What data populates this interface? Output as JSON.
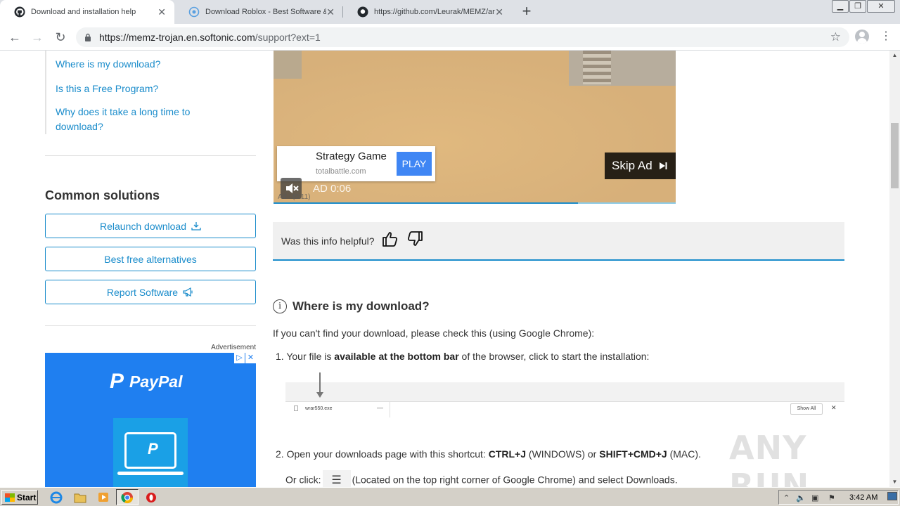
{
  "browser": {
    "tabs": [
      {
        "title": "Download and installation help",
        "active": true,
        "favicon": "github-icon"
      },
      {
        "title": "Download Roblox - Best Software &",
        "active": false,
        "favicon": "softonic-icon"
      },
      {
        "title": "https://github.com/Leurak/MEMZ/ar",
        "active": false,
        "favicon": "github-icon"
      }
    ],
    "url_host": "https://memz-trojan.en.softonic.com",
    "url_path": "/support?ext=1"
  },
  "sidebar": {
    "faq_links": [
      "Where is my download?",
      "Is this a Free Program?",
      "Why does it take a long time to download?"
    ],
    "common_title": "Common solutions",
    "buttons": [
      "Relaunch download",
      "Best free alternatives",
      "Report Software"
    ],
    "ad_label": "Advertisement",
    "ad_brand": "PayPal"
  },
  "video_ad": {
    "promo_title": "Strategy Game",
    "promo_domain": "totalbattle.com",
    "play_label": "PLAY",
    "skip_label": "Skip Ad",
    "timer": "AD  0:06",
    "small": "Ad · (0:11)",
    "progress": 0.757
  },
  "feedback": {
    "question": "Was this info helpful?"
  },
  "article": {
    "heading": "Where is my download?",
    "intro": "If you can't find your download, please check this (using Google Chrome):",
    "step1_pre": "1. Your file is ",
    "step1_bold": "available at the bottom bar",
    "step1_post": " of the browser, click to start the installation:",
    "dl_filename": "wrar550.exe",
    "dl_showall": "Show All",
    "step2_pre": "2. Open your downloads page with this shortcut: ",
    "step2_k1": "CTRL+J",
    "step2_mid": " (WINDOWS) or ",
    "step2_k2": "SHIFT+CMD+J",
    "step2_post": " (MAC).",
    "step3_pre": "Or click:",
    "step3_post": "(Located on the top right corner of Google Chrome) and select Downloads."
  },
  "watermark": "ANY RUN",
  "taskbar": {
    "start": "Start",
    "clock": "3:42 AM"
  },
  "colors": {
    "link": "#1a8ccb",
    "paypal_bg": "#1f7ff0",
    "play_btn": "#3f86f4"
  }
}
